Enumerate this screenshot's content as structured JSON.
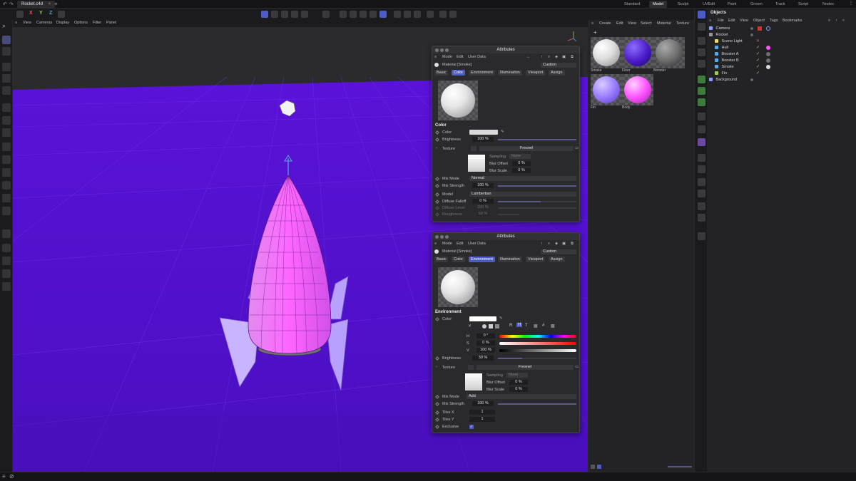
{
  "topbar": {
    "document_tab": "Rocket.c4d",
    "layouts": [
      "Standard",
      "Model",
      "Sculpt",
      "UVEdit",
      "Paint",
      "Groom",
      "Track",
      "Script",
      "Nodes"
    ],
    "active_layout": "Model"
  },
  "toolbar": {
    "axis_x": "X",
    "axis_y": "Y",
    "axis_z": "Z"
  },
  "viewport": {
    "menu": [
      "View",
      "Cameras",
      "Display",
      "Options",
      "Filter",
      "Panel"
    ],
    "colors": {
      "background": "#5a12d8",
      "floor": "#4e10c8",
      "rocket_body": "#ff66ff",
      "fins": "#c8b4ff"
    }
  },
  "attributes_top": {
    "title": "Attributes",
    "menu": [
      "Mode",
      "Edit",
      "User Data"
    ],
    "material_label": "Material [Smoke]",
    "preset": "Custom",
    "tabs": [
      "Basic",
      "Color",
      "Environment",
      "Illumination",
      "Viewport",
      "Assign"
    ],
    "active_tab": "Color",
    "section": "Color",
    "rows": {
      "color": "Color",
      "brightness": "Brightness",
      "brightness_value": "100 %",
      "texture": "Texture",
      "texture_value": "Fresnel",
      "sampling": "Sampling",
      "sampling_value": "None",
      "blur_offset": "Blur Offset",
      "blur_offset_value": "0 %",
      "blur_scale": "Blur Scale",
      "blur_scale_value": "0 %",
      "mix_mode": "Mix Mode",
      "mix_mode_value": "Normal",
      "mix_strength": "Mix Strength",
      "mix_strength_value": "100 %",
      "model": "Model",
      "model_value": "Lambertian",
      "diffuse_falloff": "Diffuse Falloff",
      "diffuse_falloff_value": "0 %",
      "diffuse_level": "Diffuse Level",
      "diffuse_level_value": "100 %",
      "roughness": "Roughness",
      "roughness_value": "50 %"
    }
  },
  "attributes_bottom": {
    "title": "Attributes",
    "menu": [
      "Mode",
      "Edit",
      "User Data"
    ],
    "material_label": "Material [Smoke]",
    "preset": "Custom",
    "tabs": [
      "Basic",
      "Color",
      "Environment",
      "Illumination",
      "Viewport",
      "Assign"
    ],
    "active_tab": "Environment",
    "section": "Environment",
    "color_mode_buttons": [
      "R",
      "H",
      "T",
      "#"
    ],
    "rows": {
      "color": "Color",
      "h": "H",
      "h_value": "0 °",
      "s": "S",
      "s_value": "0 %",
      "v": "V",
      "v_value": "100 %",
      "brightness": "Brightness",
      "brightness_value": "30 %",
      "texture": "Texture",
      "texture_value": "Fresnel",
      "sampling": "Sampling",
      "sampling_value": "None",
      "blur_offset": "Blur Offset",
      "blur_offset_value": "0 %",
      "blur_scale": "Blur Scale",
      "blur_scale_value": "0 %",
      "mix_mode": "Mix Mode",
      "mix_mode_value": "Add",
      "mix_strength": "Mix Strength",
      "mix_strength_value": "100 %",
      "tiles_x": "Tiles X",
      "tiles_x_value": "1",
      "tiles_y": "Tiles Y",
      "tiles_y_value": "1",
      "exclusive": "Exclusive"
    }
  },
  "material_manager": {
    "menu": [
      "Create",
      "Edit",
      "View",
      "Select",
      "Material",
      "Texture"
    ],
    "materials": [
      {
        "name": "Smoke",
        "color": "#d8d8d8"
      },
      {
        "name": "Floor",
        "color": "#4a1ac8"
      },
      {
        "name": "Booster",
        "color": "#707070"
      },
      {
        "name": "Fin",
        "color": "#9a7cff"
      },
      {
        "name": "Body",
        "color": "#ff55ff"
      }
    ]
  },
  "object_manager": {
    "title": "Objects",
    "menu": [
      "File",
      "Edit",
      "View",
      "Object",
      "Tags",
      "Bookmarks"
    ],
    "objects": [
      {
        "name": "Camera",
        "color": "#8aa0ff"
      },
      {
        "name": "Rocket",
        "color": "#9a9a9a"
      },
      {
        "name": "Scene Light",
        "color": "#e8e066"
      },
      {
        "name": "Hull",
        "color": "#5ca8e2"
      },
      {
        "name": "Booster A",
        "color": "#5ca8e2"
      },
      {
        "name": "Booster B",
        "color": "#5ca8e2"
      },
      {
        "name": "Smoke",
        "color": "#5ca8e2"
      },
      {
        "name": "Fin",
        "color": "#9ad15a"
      },
      {
        "name": "Background",
        "color": "#8aa0ff"
      }
    ]
  }
}
